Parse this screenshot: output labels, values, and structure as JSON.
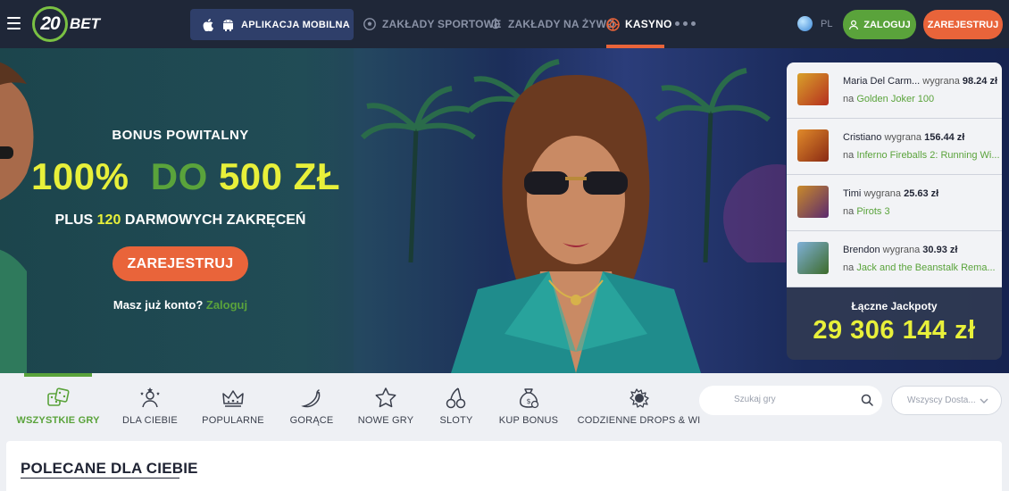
{
  "header": {
    "logo_number": "20",
    "logo_text": "BET",
    "app_button": "APLIKACJA MOBILNA",
    "nav": [
      {
        "label": "ZAKŁADY SPORTOWE",
        "icon": "soccer-ball-icon"
      },
      {
        "label": "ZAKŁADY NA ŻYWO",
        "icon": "live-icon"
      },
      {
        "label": "KASYNO",
        "icon": "roulette-icon",
        "active": true
      }
    ],
    "language": "PL",
    "login": "ZALOGUJ",
    "register": "ZAREJESTRUJ"
  },
  "hero": {
    "bonus_title": "BONUS POWITALNY",
    "bonus_percent": "100%",
    "bonus_do": "DO",
    "bonus_value": "500 ZŁ",
    "plus_prefix": "PLUS",
    "plus_number": "120",
    "plus_suffix": "DARMOWYCH ZAKRĘCEŃ",
    "register_button": "ZAREJESTRUJ",
    "have_account": "Masz już konto?",
    "login_link": "Zaloguj"
  },
  "winners": {
    "items": [
      {
        "name": "Maria Del Carm...",
        "label": "wygrana",
        "amount": "98.24 zł",
        "prefix": "na",
        "game": "Golden Joker 100",
        "thumb_color": "#b5301f"
      },
      {
        "name": "Cristiano",
        "label": "wygrana",
        "amount": "156.44 zł",
        "prefix": "na",
        "game": "Inferno Fireballs 2: Running Wi...",
        "thumb_color": "#8a2a14"
      },
      {
        "name": "Timi",
        "label": "wygrana",
        "amount": "25.63 zł",
        "prefix": "na",
        "game": "Pirots 3",
        "thumb_color": "#5b2a6e"
      },
      {
        "name": "Brendon",
        "label": "wygrana",
        "amount": "30.93 zł",
        "prefix": "na",
        "game": "Jack and the Beanstalk Rema...",
        "thumb_color": "#3d6b2a"
      }
    ],
    "jackpot_label": "Łączne Jackpoty",
    "jackpot_value": "29 306 144 zł"
  },
  "categories": {
    "items": [
      {
        "label": "WSZYSTKIE GRY",
        "icon": "dice-icon",
        "active": true
      },
      {
        "label": "DLA CIEBIE",
        "icon": "user-star-icon"
      },
      {
        "label": "POPULARNE",
        "icon": "crown-icon"
      },
      {
        "label": "GORĄCE",
        "icon": "chili-icon"
      },
      {
        "label": "NOWE GRY",
        "icon": "star-icon"
      },
      {
        "label": "SLOTY",
        "icon": "cherries-icon"
      },
      {
        "label": "KUP BONUS",
        "icon": "money-bag-icon"
      },
      {
        "label": "CODZIENNE DROPS & WI",
        "icon": "drops-wins-icon"
      }
    ],
    "search_placeholder": "Szukaj gry",
    "provider_placeholder": "Wszyscy Dosta..."
  },
  "section": {
    "title": "POLECANE DLA CIEBIE"
  },
  "colors": {
    "accent_orange": "#e9643a",
    "accent_green": "#5aa33b",
    "highlight_yellow": "#e8f03a",
    "header_bg": "#1f2738"
  }
}
